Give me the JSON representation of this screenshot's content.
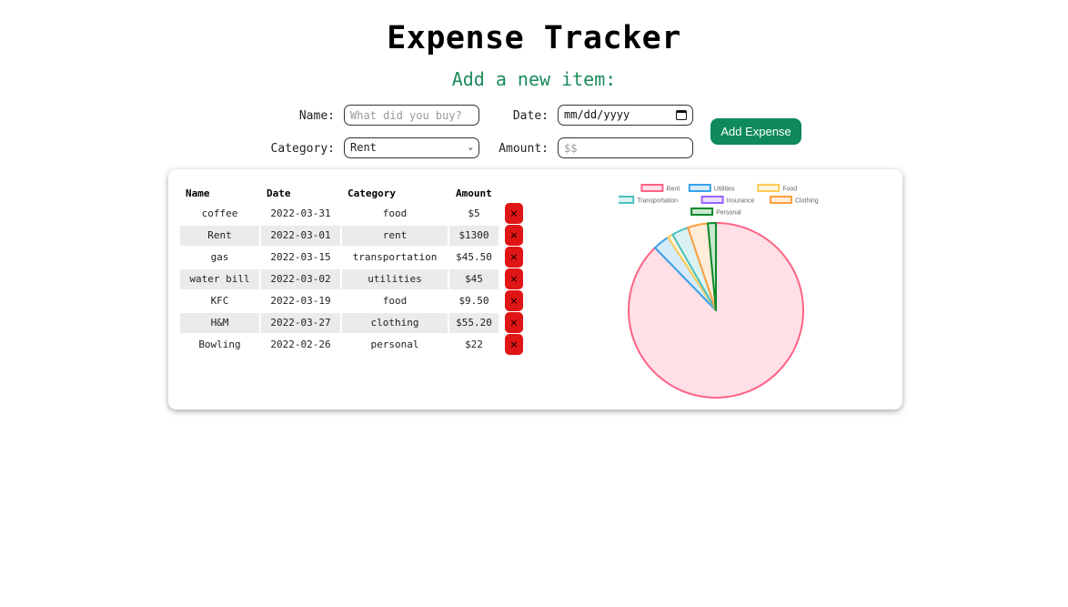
{
  "header": {
    "title": "Expense Tracker",
    "subtitle": "Add a new item:"
  },
  "form": {
    "name_label": "Name:",
    "name_placeholder": "What did you buy?",
    "date_label": "Date:",
    "date_placeholder": "mm/dd/yyyy",
    "category_label": "Category:",
    "category_value": "Rent",
    "amount_label": "Amount:",
    "amount_placeholder": "$$",
    "add_button": "Add Expense"
  },
  "table": {
    "headers": [
      "Name",
      "Date",
      "Category",
      "Amount"
    ],
    "delete_symbol": "×",
    "rows": [
      {
        "name": "coffee",
        "date": "2022-03-31",
        "category": "food",
        "amount": "$5"
      },
      {
        "name": "Rent",
        "date": "2022-03-01",
        "category": "rent",
        "amount": "$1300"
      },
      {
        "name": "gas",
        "date": "2022-03-15",
        "category": "transportation",
        "amount": "$45.50"
      },
      {
        "name": "water bill",
        "date": "2022-03-02",
        "category": "utilities",
        "amount": "$45"
      },
      {
        "name": "KFC",
        "date": "2022-03-19",
        "category": "food",
        "amount": "$9.50"
      },
      {
        "name": "H&M",
        "date": "2022-03-27",
        "category": "clothing",
        "amount": "$55.20"
      },
      {
        "name": "Bowling",
        "date": "2022-02-26",
        "category": "personal",
        "amount": "$22"
      }
    ]
  },
  "chart_data": {
    "type": "pie",
    "categories": [
      "Rent",
      "Utilities",
      "Food",
      "Transportation",
      "Insurance",
      "Clothing",
      "Personal"
    ],
    "values": [
      1300,
      45,
      14.5,
      45.5,
      0,
      55.2,
      22
    ],
    "colors": [
      "#ff6384",
      "#36a2eb",
      "#ffcd56",
      "#4bc0c0",
      "#9966ff",
      "#ff9f40",
      "#0a8a2a"
    ],
    "fill_colors": [
      "#ffe0e6",
      "#d7ecfb",
      "#fff5dd",
      "#dbf2f2",
      "#ebe0ff",
      "#ffecd9",
      "#c8e8cf"
    ],
    "legend_position": "top"
  }
}
